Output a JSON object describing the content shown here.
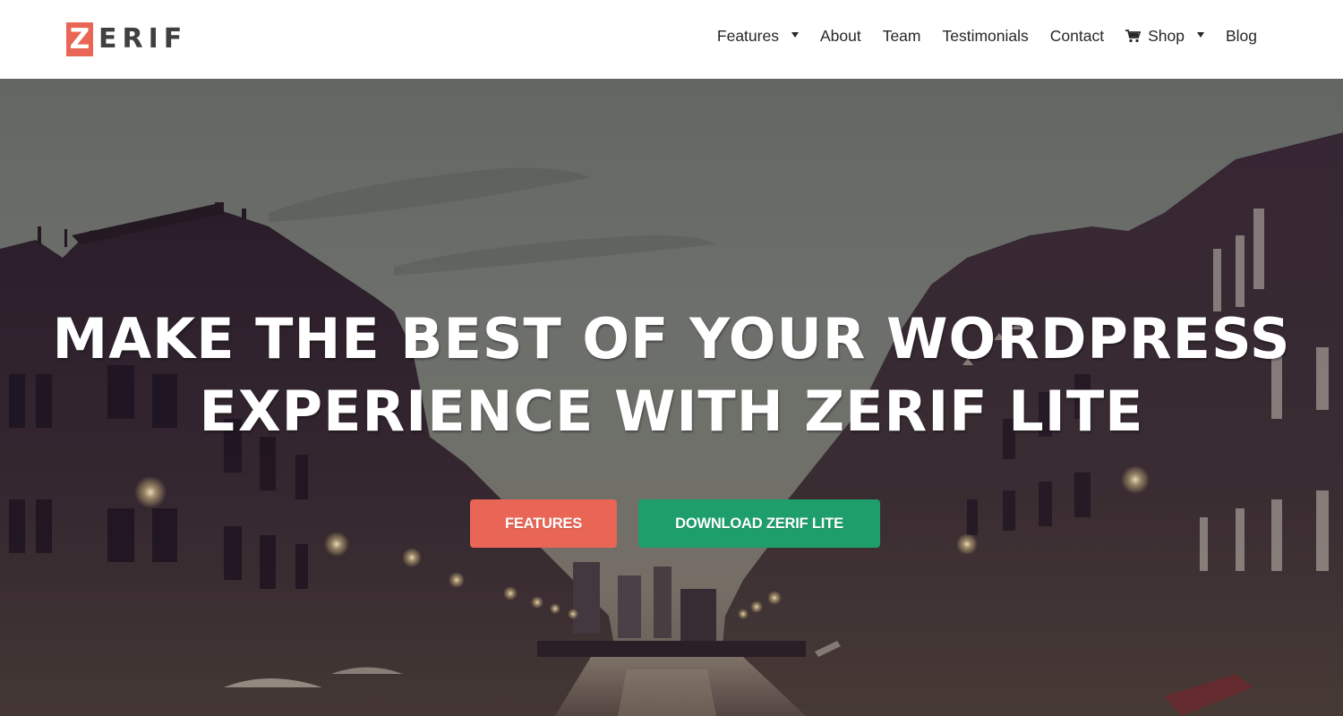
{
  "header": {
    "logo": {
      "first_letter": "Z",
      "rest": "ERIF"
    },
    "nav": [
      {
        "label": "Features",
        "has_dropdown": true
      },
      {
        "label": "About",
        "has_dropdown": false
      },
      {
        "label": "Team",
        "has_dropdown": false
      },
      {
        "label": "Testimonials",
        "has_dropdown": false
      },
      {
        "label": "Contact",
        "has_dropdown": false
      },
      {
        "label": "Shop",
        "has_dropdown": true,
        "icon": "cart-icon"
      },
      {
        "label": "Blog",
        "has_dropdown": false
      }
    ]
  },
  "hero": {
    "title_line1": "MAKE THE BEST OF YOUR WORDPRESS",
    "title_line2": "EXPERIENCE WITH ZERIF LITE",
    "buttons": {
      "primary": "FEATURES",
      "secondary": "DOWNLOAD ZERIF LITE"
    },
    "background": "city-canal-dusk-photo"
  },
  "colors": {
    "accent_red": "#e96656",
    "accent_green": "#1e9e6b",
    "nav_text": "#272727",
    "logo_text": "#404040"
  }
}
